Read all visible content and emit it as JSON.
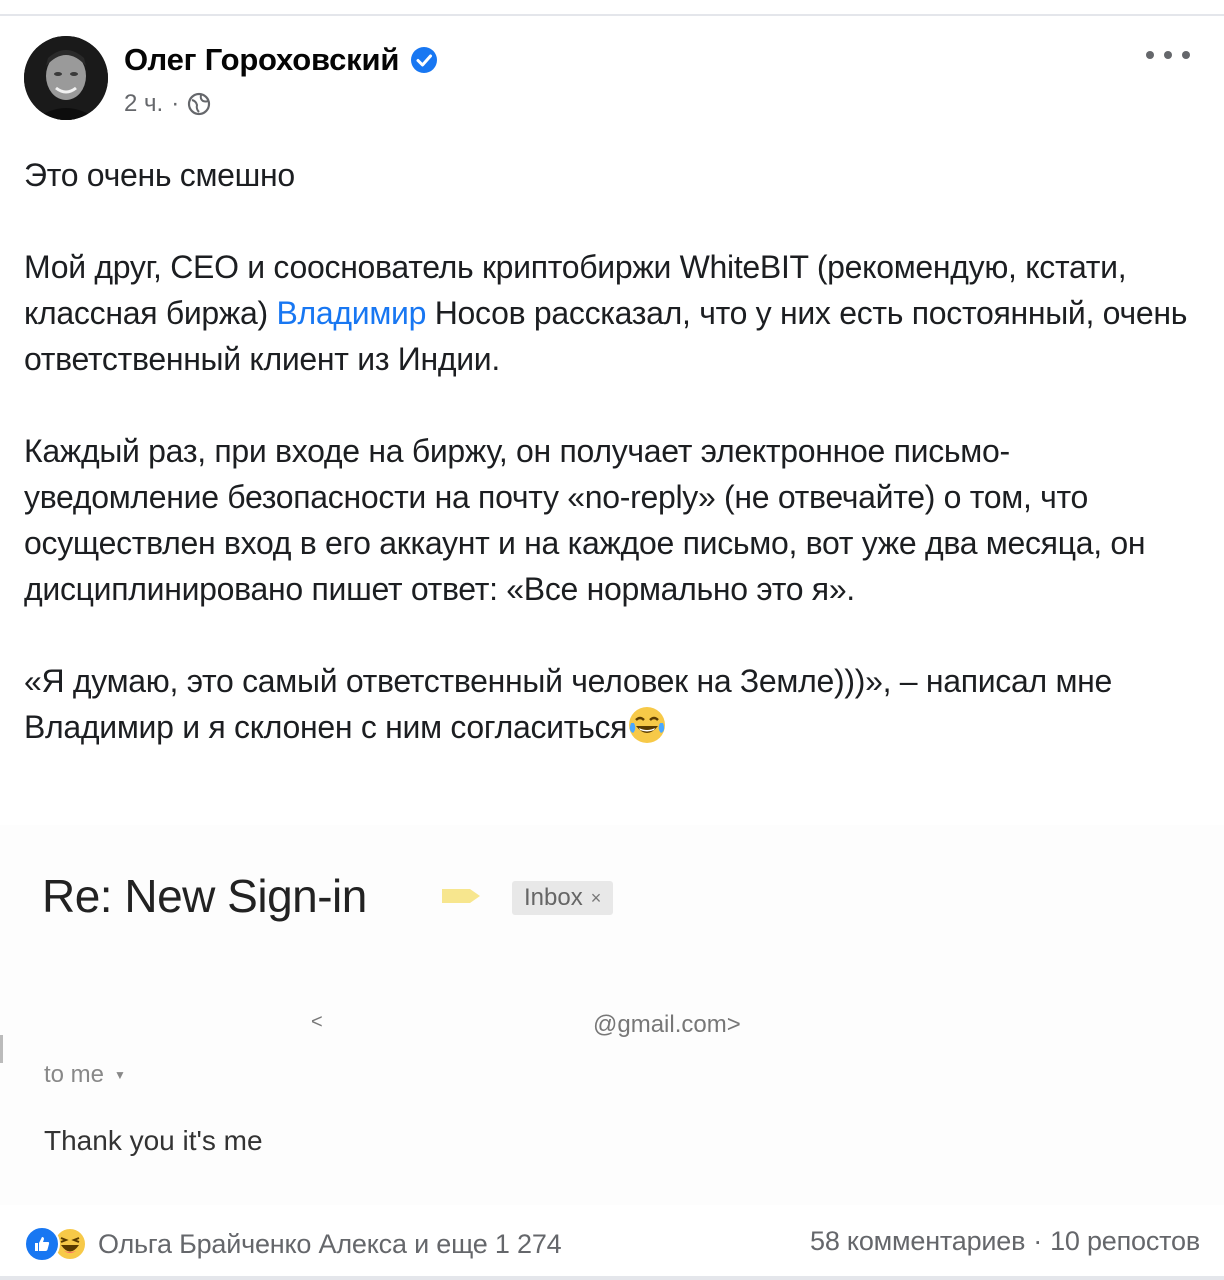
{
  "post": {
    "author": "Олег Гороховский",
    "time": "2 ч.",
    "separator": "·",
    "paragraphs": [
      "Это очень смешно",
      "",
      "Мой друг, CEO и сооснователь криптобиржи WhiteBIT (рекомендую, кстати, классная биржа)",
      "Владимир",
      "Носов рассказал, что у них есть постоянный, очень ответственный клиент из Индии.",
      "Каждый раз, при входе на биржу, он получает электронное письмо-уведомление безопасности на почту «no-reply» (не отвечайте) о том, что осуществлен вход в его аккаунт и на каждое письмо, вот уже два месяца, он дисциплинировано пишет ответ: «Все нормально это я».",
      "«Я думаю, это самый ответственный человек на Земле)))», – написал мне Владимир и я склонен с ним согласиться"
    ]
  },
  "email": {
    "subject": "Re: New Sign-in",
    "label": "Inbox",
    "label_close": "×",
    "sender_lt": "<",
    "sender_email": "@gmail.com>",
    "to": "to me",
    "body": "Thank you it's me"
  },
  "footer": {
    "reactors": "Ольга Брайченко Алекса и еще 1 274",
    "comments": "58 комментариев",
    "dot": "·",
    "shares": "10 репостов"
  },
  "colors": {
    "link": "#1877f2",
    "secondary_text": "#65676b",
    "divider": "#e4e6eb"
  },
  "icons": [
    "verified-badge-icon",
    "globe-icon",
    "more-options-icon",
    "laughing-emoji-icon",
    "label-arrow-icon",
    "like-reaction-icon",
    "haha-reaction-icon"
  ]
}
